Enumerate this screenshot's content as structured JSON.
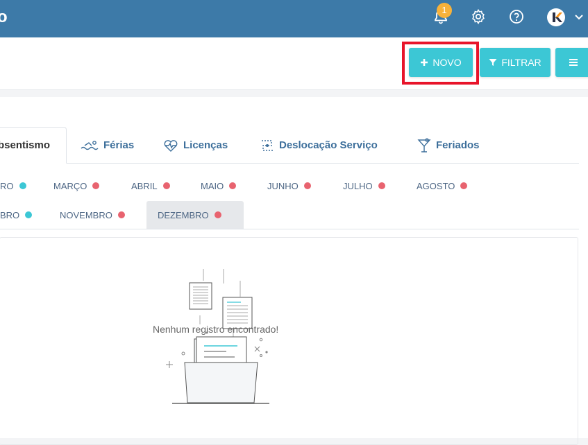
{
  "header": {
    "brand_text": "o",
    "notification_count": "1",
    "icons": [
      "bell-icon",
      "gear-icon",
      "help-icon",
      "avatar-logo",
      "chevron-down-icon"
    ]
  },
  "toolbar": {
    "new_label": "NOVO",
    "filter_label": "FILTRAR"
  },
  "tabs": [
    {
      "label": "bsentismo",
      "icon": "absence-icon",
      "active": true
    },
    {
      "label": "Férias",
      "icon": "swimmer-icon",
      "active": false
    },
    {
      "label": "Licenças",
      "icon": "heartbeat-icon",
      "active": false
    },
    {
      "label": "Deslocação Serviço",
      "icon": "route-icon",
      "active": false
    },
    {
      "label": "Feriados",
      "icon": "cocktail-icon",
      "active": false
    }
  ],
  "months_row1": [
    {
      "label": "RO",
      "status": "teal"
    },
    {
      "label": "MARÇO",
      "status": "red"
    },
    {
      "label": "ABRIL",
      "status": "red"
    },
    {
      "label": "MAIO",
      "status": "red"
    },
    {
      "label": "JUNHO",
      "status": "red"
    },
    {
      "label": "JULHO",
      "status": "red"
    },
    {
      "label": "AGOSTO",
      "status": "red"
    }
  ],
  "months_row2": [
    {
      "label": "BRO",
      "status": "teal"
    },
    {
      "label": "NOVEMBRO",
      "status": "red"
    },
    {
      "label": "DEZEMBRO",
      "status": "red",
      "active": true
    }
  ],
  "colors": {
    "teal": "#3cc7d5",
    "red": "#e8636f",
    "header": "#3d7aa8"
  },
  "empty": {
    "message": "Nenhum registro encontrado!"
  }
}
